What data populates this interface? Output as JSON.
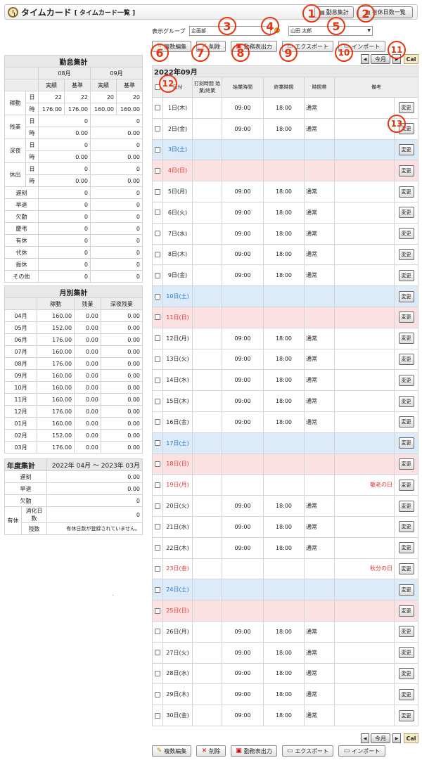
{
  "header": {
    "title": "タイムカード",
    "subtitle": "[ タイムカード一覧 ]",
    "btn_summary": "勤怠集計",
    "btn_holidays": "有休日数一覧"
  },
  "filter": {
    "group_label": "表示グループ",
    "group_value": "企画部",
    "user_value": "山田 太郎"
  },
  "toolbar": {
    "multi_edit": "複数編集",
    "delete": "削除",
    "print": "勤務表出力",
    "export": "エクスポート",
    "import": "インポート"
  },
  "nav": {
    "prev": "◀",
    "this_month": "今月",
    "next": "▶",
    "cal": "Cal"
  },
  "callouts": [
    "1",
    "2",
    "3",
    "4",
    "5",
    "6",
    "7",
    "8",
    "9",
    "10",
    "11",
    "12",
    "13"
  ],
  "attendance": {
    "title": "勤怠集計",
    "months": [
      "08月",
      "09月"
    ],
    "sub_headers": [
      "実績",
      "基準",
      "実績",
      "基準"
    ],
    "groups": [
      {
        "name": "稼動",
        "rows": [
          {
            "unit": "日",
            "vals": [
              "22",
              "22",
              "20",
              "20"
            ]
          },
          {
            "unit": "時",
            "vals": [
              "176.00",
              "176.00",
              "160.00",
              "160.00"
            ]
          }
        ]
      },
      {
        "name": "残業",
        "rows": [
          {
            "unit": "日",
            "vals": [
              "0",
              "0"
            ]
          },
          {
            "unit": "時",
            "vals": [
              "0.00",
              "0.00"
            ]
          }
        ]
      },
      {
        "name": "深夜",
        "rows": [
          {
            "unit": "日",
            "vals": [
              "0",
              "0"
            ]
          },
          {
            "unit": "時",
            "vals": [
              "0.00",
              "0.00"
            ]
          }
        ]
      },
      {
        "name": "休出",
        "rows": [
          {
            "unit": "日",
            "vals": [
              "0",
              "0"
            ]
          },
          {
            "unit": "時",
            "vals": [
              "0.00",
              "0.00"
            ]
          }
        ]
      }
    ],
    "singles": [
      {
        "name": "遅刻",
        "vals": [
          "0",
          "0"
        ]
      },
      {
        "name": "早退",
        "vals": [
          "0",
          "0"
        ]
      },
      {
        "name": "欠勤",
        "vals": [
          "0",
          "0"
        ]
      },
      {
        "name": "慶弔",
        "vals": [
          "0",
          "0"
        ]
      },
      {
        "name": "有休",
        "vals": [
          "0",
          "0"
        ]
      },
      {
        "name": "代休",
        "vals": [
          "0",
          "0"
        ]
      },
      {
        "name": "振休",
        "vals": [
          "0",
          "0"
        ]
      },
      {
        "name": "その他",
        "vals": [
          "0",
          "0"
        ]
      }
    ]
  },
  "monthly": {
    "title": "月別集計",
    "headers": [
      "稼動",
      "残業",
      "深夜残業"
    ],
    "rows": [
      {
        "month": "04月",
        "vals": [
          "160.00",
          "0.00",
          "0.00"
        ]
      },
      {
        "month": "05月",
        "vals": [
          "152.00",
          "0.00",
          "0.00"
        ]
      },
      {
        "month": "06月",
        "vals": [
          "176.00",
          "0.00",
          "0.00"
        ]
      },
      {
        "month": "07月",
        "vals": [
          "160.00",
          "0.00",
          "0.00"
        ]
      },
      {
        "month": "08月",
        "vals": [
          "176.00",
          "0.00",
          "0.00"
        ]
      },
      {
        "month": "09月",
        "vals": [
          "160.00",
          "0.00",
          "0.00"
        ]
      },
      {
        "month": "10月",
        "vals": [
          "160.00",
          "0.00",
          "0.00"
        ]
      },
      {
        "month": "11月",
        "vals": [
          "160.00",
          "0.00",
          "0.00"
        ]
      },
      {
        "month": "12月",
        "vals": [
          "176.00",
          "0.00",
          "0.00"
        ]
      },
      {
        "month": "01月",
        "vals": [
          "160.00",
          "0.00",
          "0.00"
        ]
      },
      {
        "month": "02月",
        "vals": [
          "152.00",
          "0.00",
          "0.00"
        ]
      },
      {
        "month": "03月",
        "vals": [
          "176.00",
          "0.00",
          "0.00"
        ]
      }
    ]
  },
  "yearly": {
    "title": "年度集計",
    "period": "2022年 04月 ～ 2023年 03月",
    "rows": [
      {
        "name": "遅刻",
        "val": "0.00"
      },
      {
        "name": "早退",
        "val": "0.00"
      },
      {
        "name": "欠勤",
        "val": "0"
      }
    ],
    "paid_label": "有休",
    "paid_used_label": "消化日数",
    "paid_used_val": "0",
    "paid_left_label": "残数",
    "paid_left_val": "有休日数が登録されていません。"
  },
  "calendar": {
    "title": "2022年09月",
    "headers": [
      "日付",
      "打刻時間 始業/終業",
      "始業時間",
      "終業時間",
      "時間帯",
      "備考"
    ],
    "change_label": "変更",
    "days": [
      {
        "label": "1日(木)",
        "type": "w",
        "start": "09:00",
        "end": "18:00",
        "slot": "通常",
        "note": ""
      },
      {
        "label": "2日(金)",
        "type": "w",
        "start": "09:00",
        "end": "18:00",
        "slot": "通常",
        "note": ""
      },
      {
        "label": "3日(土)",
        "type": "sat",
        "start": "",
        "end": "",
        "slot": "",
        "note": ""
      },
      {
        "label": "4日(日)",
        "type": "sun",
        "start": "",
        "end": "",
        "slot": "",
        "note": ""
      },
      {
        "label": "5日(月)",
        "type": "w",
        "start": "09:00",
        "end": "18:00",
        "slot": "通常",
        "note": ""
      },
      {
        "label": "6日(火)",
        "type": "w",
        "start": "09:00",
        "end": "18:00",
        "slot": "通常",
        "note": ""
      },
      {
        "label": "7日(水)",
        "type": "w",
        "start": "09:00",
        "end": "18:00",
        "slot": "通常",
        "note": ""
      },
      {
        "label": "8日(木)",
        "type": "w",
        "start": "09:00",
        "end": "18:00",
        "slot": "通常",
        "note": ""
      },
      {
        "label": "9日(金)",
        "type": "w",
        "start": "09:00",
        "end": "18:00",
        "slot": "通常",
        "note": ""
      },
      {
        "label": "10日(土)",
        "type": "sat",
        "start": "",
        "end": "",
        "slot": "",
        "note": ""
      },
      {
        "label": "11日(日)",
        "type": "sun",
        "start": "",
        "end": "",
        "slot": "",
        "note": ""
      },
      {
        "label": "12日(月)",
        "type": "w",
        "start": "09:00",
        "end": "18:00",
        "slot": "通常",
        "note": ""
      },
      {
        "label": "13日(火)",
        "type": "w",
        "start": "09:00",
        "end": "18:00",
        "slot": "通常",
        "note": ""
      },
      {
        "label": "14日(水)",
        "type": "w",
        "start": "09:00",
        "end": "18:00",
        "slot": "通常",
        "note": ""
      },
      {
        "label": "15日(木)",
        "type": "w",
        "start": "09:00",
        "end": "18:00",
        "slot": "通常",
        "note": ""
      },
      {
        "label": "16日(金)",
        "type": "w",
        "start": "09:00",
        "end": "18:00",
        "slot": "通常",
        "note": ""
      },
      {
        "label": "17日(土)",
        "type": "sat",
        "start": "",
        "end": "",
        "slot": "",
        "note": ""
      },
      {
        "label": "18日(日)",
        "type": "sun",
        "start": "",
        "end": "",
        "slot": "",
        "note": ""
      },
      {
        "label": "19日(月)",
        "type": "hol",
        "start": "",
        "end": "",
        "slot": "",
        "note": "敬老の日"
      },
      {
        "label": "20日(火)",
        "type": "w",
        "start": "09:00",
        "end": "18:00",
        "slot": "通常",
        "note": ""
      },
      {
        "label": "21日(水)",
        "type": "w",
        "start": "09:00",
        "end": "18:00",
        "slot": "通常",
        "note": ""
      },
      {
        "label": "22日(木)",
        "type": "w",
        "start": "09:00",
        "end": "18:00",
        "slot": "通常",
        "note": ""
      },
      {
        "label": "23日(金)",
        "type": "hol",
        "start": "",
        "end": "",
        "slot": "",
        "note": "秋分の日"
      },
      {
        "label": "24日(土)",
        "type": "sat",
        "start": "",
        "end": "",
        "slot": "",
        "note": ""
      },
      {
        "label": "25日(日)",
        "type": "sun",
        "start": "",
        "end": "",
        "slot": "",
        "note": ""
      },
      {
        "label": "26日(月)",
        "type": "w",
        "start": "09:00",
        "end": "18:00",
        "slot": "通常",
        "note": ""
      },
      {
        "label": "27日(火)",
        "type": "w",
        "start": "09:00",
        "end": "18:00",
        "slot": "通常",
        "note": ""
      },
      {
        "label": "28日(水)",
        "type": "w",
        "start": "09:00",
        "end": "18:00",
        "slot": "通常",
        "note": ""
      },
      {
        "label": "29日(木)",
        "type": "w",
        "start": "09:00",
        "end": "18:00",
        "slot": "通常",
        "note": ""
      },
      {
        "label": "30日(金)",
        "type": "w",
        "start": "09:00",
        "end": "18:00",
        "slot": "通常",
        "note": ""
      }
    ]
  },
  "colors": {
    "callout": "#e83510",
    "saturday_bg": "#dcebfa",
    "sunday_bg": "#fbe1e1",
    "saturday_text": "#2075c9",
    "sunday_text": "#e0332c"
  }
}
